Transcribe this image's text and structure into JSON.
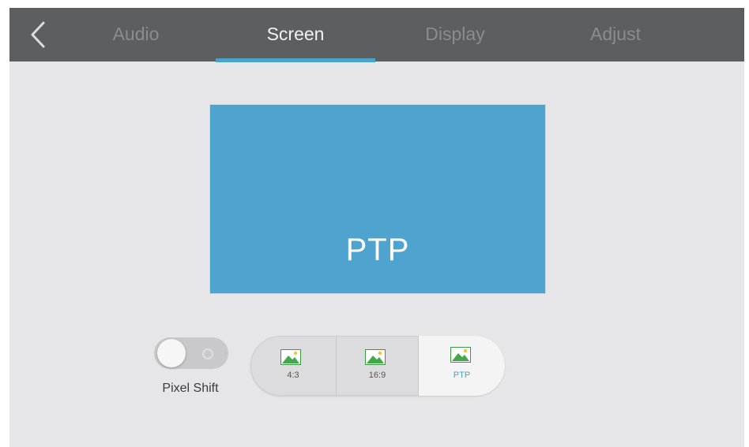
{
  "topbar": {
    "back_icon": "chevron-left-icon",
    "tabs": [
      {
        "label": "Audio",
        "active": false
      },
      {
        "label": "Screen",
        "active": true
      },
      {
        "label": "Display",
        "active": false
      },
      {
        "label": "Adjust",
        "active": false
      }
    ]
  },
  "preview": {
    "label": "PTP"
  },
  "pixel_shift": {
    "label": "Pixel Shift",
    "enabled": false
  },
  "aspect": {
    "options": [
      {
        "label": "4:3",
        "icon": "landscape-image-icon",
        "selected": false
      },
      {
        "label": "16:9",
        "icon": "landscape-image-icon",
        "selected": false
      },
      {
        "label": "PTP",
        "icon": "landscape-image-icon",
        "selected": true
      }
    ]
  },
  "colors": {
    "topbar": "#5d5e60",
    "accent": "#4aa3cd",
    "preview": "#4fa3cf",
    "background": "#e6e6e8"
  }
}
